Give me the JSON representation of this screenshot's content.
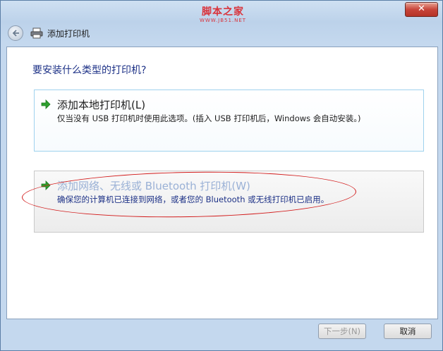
{
  "window": {
    "close_glyph": "✕",
    "watermark_title": "脚本之家",
    "watermark_url": "WWW.JB51.NET"
  },
  "nav": {
    "title": "添加打印机",
    "back_icon": "back-arrow-icon",
    "printer_icon": "printer-icon"
  },
  "main": {
    "heading": "要安装什么类型的打印机?",
    "options": [
      {
        "title": "添加本地打印机(L)",
        "description": "仅当没有 USB 打印机时使用此选项。(插入 USB 打印机后，Windows 会自动安装。)",
        "icon": "green-arrow-icon"
      },
      {
        "title": "添加网络、无线或 Bluetooth 打印机(W)",
        "description": "确保您的计算机已连接到网络，或者您的 Bluetooth 或无线打印机已启用。",
        "icon": "green-arrow-icon"
      }
    ]
  },
  "footer": {
    "next_label": "下一步(N)",
    "cancel_label": "取消"
  },
  "colors": {
    "heading": "#1e3287",
    "annotation": "#d21a1a",
    "accent_green": "#2ea02e"
  }
}
